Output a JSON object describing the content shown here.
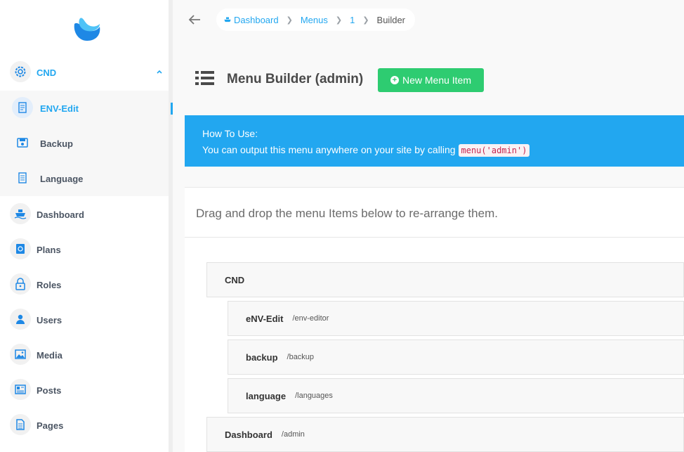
{
  "sidebar": {
    "items": [
      {
        "label": "CND",
        "icon": "settings-icon"
      },
      {
        "label": "ENV-Edit",
        "icon": "document-edit-icon"
      },
      {
        "label": "Backup",
        "icon": "backup-icon"
      },
      {
        "label": "Language",
        "icon": "document-icon"
      },
      {
        "label": "Dashboard",
        "icon": "boat-icon"
      },
      {
        "label": "Plans",
        "icon": "calendar-icon"
      },
      {
        "label": "Roles",
        "icon": "lock-icon"
      },
      {
        "label": "Users",
        "icon": "person-icon"
      },
      {
        "label": "Media",
        "icon": "images-icon"
      },
      {
        "label": "Posts",
        "icon": "news-icon"
      },
      {
        "label": "Pages",
        "icon": "file-text-icon"
      }
    ]
  },
  "breadcrumb": {
    "items": [
      "Dashboard",
      "Menus",
      "1",
      "Builder"
    ]
  },
  "header": {
    "title": "Menu Builder (admin)",
    "new_button": "New Menu Item"
  },
  "info": {
    "title": "How To Use:",
    "text": "You can output this menu anywhere on your site by calling",
    "code": "menu('admin')"
  },
  "panel": {
    "instruction": "Drag and drop the menu Items below to re-arrange them."
  },
  "menu_items": [
    {
      "title": "CND",
      "url": ""
    },
    {
      "title": "eNV-Edit",
      "url": "/env-editor"
    },
    {
      "title": "backup",
      "url": "/backup"
    },
    {
      "title": "language",
      "url": "/languages"
    },
    {
      "title": "Dashboard",
      "url": "/admin"
    }
  ],
  "colors": {
    "accent": "#22a7f0",
    "success": "#2ecc71",
    "code_text": "#c7254e"
  }
}
